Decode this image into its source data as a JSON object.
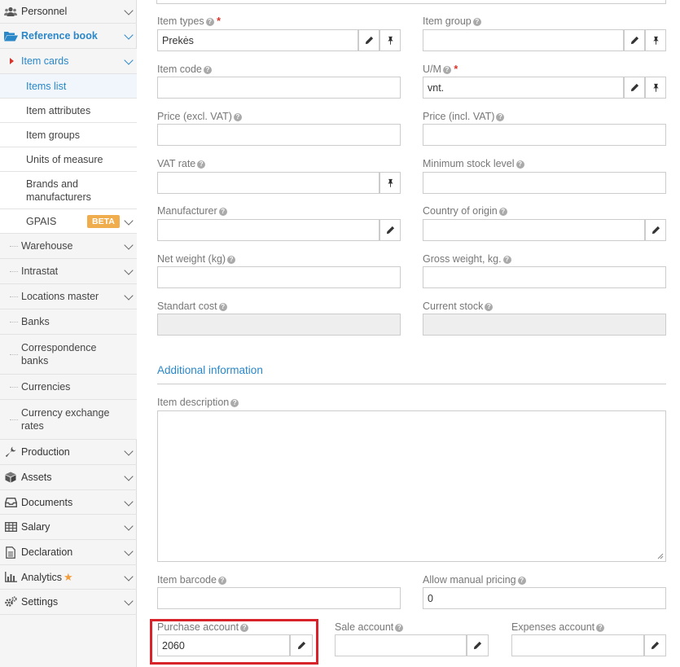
{
  "sidebar": {
    "personnel": "Personnel",
    "reference_book": "Reference book",
    "item_cards": "Item cards",
    "items_list": "Items list",
    "item_attributes": "Item attributes",
    "item_groups": "Item groups",
    "units_of_measure": "Units of measure",
    "brands_line1": "Brands and",
    "brands_line2": "manufacturers",
    "gpais": "GPAIS",
    "beta": "BETA",
    "warehouse": "Warehouse",
    "intrastat": "Intrastat",
    "locations_master": "Locations master",
    "banks": "Banks",
    "correspondence_line1": "Correspondence",
    "correspondence_line2": "banks",
    "currencies": "Currencies",
    "currency_rates_line1": "Currency exchange",
    "currency_rates_line2": "rates",
    "production": "Production",
    "assets": "Assets",
    "documents": "Documents",
    "salary": "Salary",
    "declaration": "Declaration",
    "analytics": "Analytics",
    "settings": "Settings"
  },
  "form": {
    "item_types_label": "Item types",
    "item_types_value": "Prekės",
    "item_group_label": "Item group",
    "item_group_value": "",
    "item_code_label": "Item code",
    "item_code_value": "",
    "um_label": "U/M",
    "um_value": "vnt.",
    "price_excl_label": "Price (excl. VAT)",
    "price_excl_value": "",
    "price_incl_label": "Price (incl. VAT)",
    "price_incl_value": "",
    "vat_rate_label": "VAT rate",
    "vat_rate_value": "",
    "min_stock_label": "Minimum stock level",
    "min_stock_value": "",
    "manufacturer_label": "Manufacturer",
    "manufacturer_value": "",
    "country_label": "Country of origin",
    "country_value": "",
    "net_weight_label": "Net weight (kg)",
    "net_weight_value": "",
    "gross_weight_label": "Gross weight, kg.",
    "gross_weight_value": "",
    "standart_cost_label": "Standart cost",
    "standart_cost_value": "",
    "current_stock_label": "Current stock",
    "current_stock_value": "",
    "additional_info": "Additional information",
    "item_description_label": "Item description",
    "item_barcode_label": "Item barcode",
    "item_barcode_value": "",
    "manual_pricing_label": "Allow manual pricing",
    "manual_pricing_value": "0",
    "purchase_account_label": "Purchase account",
    "purchase_account_value": "2060",
    "sale_account_label": "Sale account",
    "sale_account_value": "",
    "expenses_account_label": "Expenses account",
    "expenses_account_value": ""
  },
  "colors": {
    "accent": "#2a87c8",
    "required": "#d9342b",
    "highlight": "#d9232a",
    "beta_badge": "#f0ad4e"
  }
}
